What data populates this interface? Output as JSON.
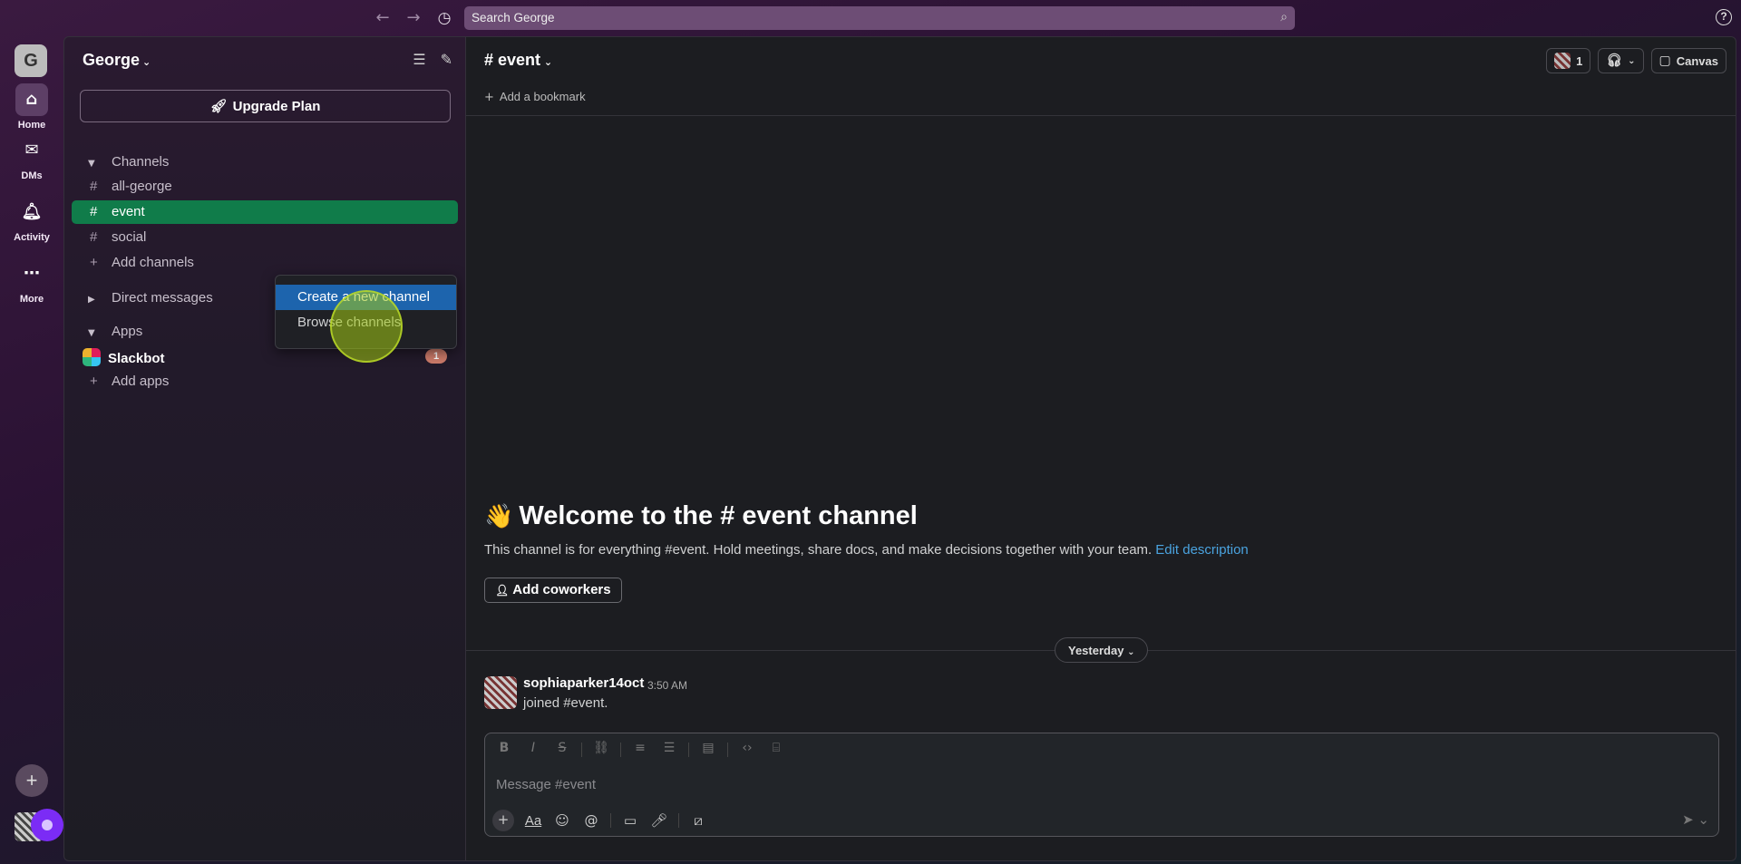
{
  "search": {
    "placeholder": "Search George"
  },
  "rail": {
    "workspace_initial": "G",
    "items": [
      {
        "label": "Home"
      },
      {
        "label": "DMs"
      },
      {
        "label": "Activity"
      },
      {
        "label": "More"
      }
    ]
  },
  "sidebar": {
    "workspace_name": "George",
    "upgrade_label": "Upgrade Plan",
    "channels_header": "Channels",
    "channels": [
      {
        "name": "all-george"
      },
      {
        "name": "event"
      },
      {
        "name": "social"
      }
    ],
    "add_channels": "Add channels",
    "direct_messages_header": "Direct messages",
    "apps_header": "Apps",
    "slackbot": {
      "name": "Slackbot",
      "badge": "1"
    },
    "add_apps": "Add apps"
  },
  "popup": {
    "items": [
      {
        "label": "Create a new channel"
      },
      {
        "label": "Browse channels"
      }
    ]
  },
  "channel": {
    "title": "event",
    "member_count": "1",
    "canvas_label": "Canvas",
    "add_bookmark": "Add a bookmark",
    "welcome_prefix": "Welcome to the",
    "welcome_suffix": "event channel",
    "description": "This channel is for everything #event. Hold meetings, share docs, and make decisions together with your team.",
    "edit_description": "Edit description",
    "add_coworkers": "Add coworkers",
    "day_label": "Yesterday",
    "message": {
      "user": "sophiaparker14oct",
      "time": "3:50 AM",
      "text": "joined #event."
    },
    "composer_placeholder": "Message #event"
  },
  "colors": {
    "active_channel": "#107c4a",
    "menu_highlight": "#1d64ad",
    "link": "#4aa3df",
    "badge": "#cd7b6a"
  }
}
